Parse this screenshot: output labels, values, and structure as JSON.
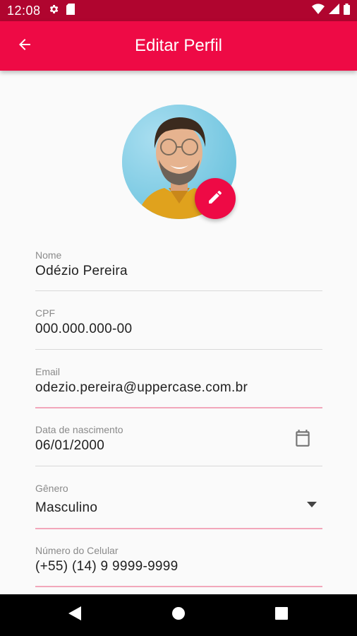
{
  "status_bar": {
    "time": "12:08",
    "icons": [
      "settings-icon",
      "sim-card-icon",
      "wifi-icon",
      "signal-icon",
      "battery-icon"
    ]
  },
  "app_bar": {
    "title": "Editar Perfil",
    "back_icon": "arrow-back-icon",
    "color": "#ee0a45"
  },
  "profile": {
    "edit_icon": "pencil-icon"
  },
  "form": {
    "name": {
      "label": "Nome",
      "value": "Odézio Pereira"
    },
    "cpf": {
      "label": "CPF",
      "value": "000.000.000-00"
    },
    "email": {
      "label": "Email",
      "value": "odezio.pereira@uppercase.com.br"
    },
    "birth_date": {
      "label": "Data de nascimento",
      "value": "06/01/2000",
      "icon": "calendar-icon"
    },
    "gender": {
      "label": "Gênero",
      "value": "Masculino",
      "icon": "dropdown-arrow-icon"
    },
    "phone": {
      "label": "Número do Celular",
      "value": "(+55) (14) 9 9999-9999"
    }
  },
  "nav_bar": {
    "icons": [
      "back-triangle-icon",
      "home-circle-icon",
      "recents-square-icon"
    ]
  }
}
